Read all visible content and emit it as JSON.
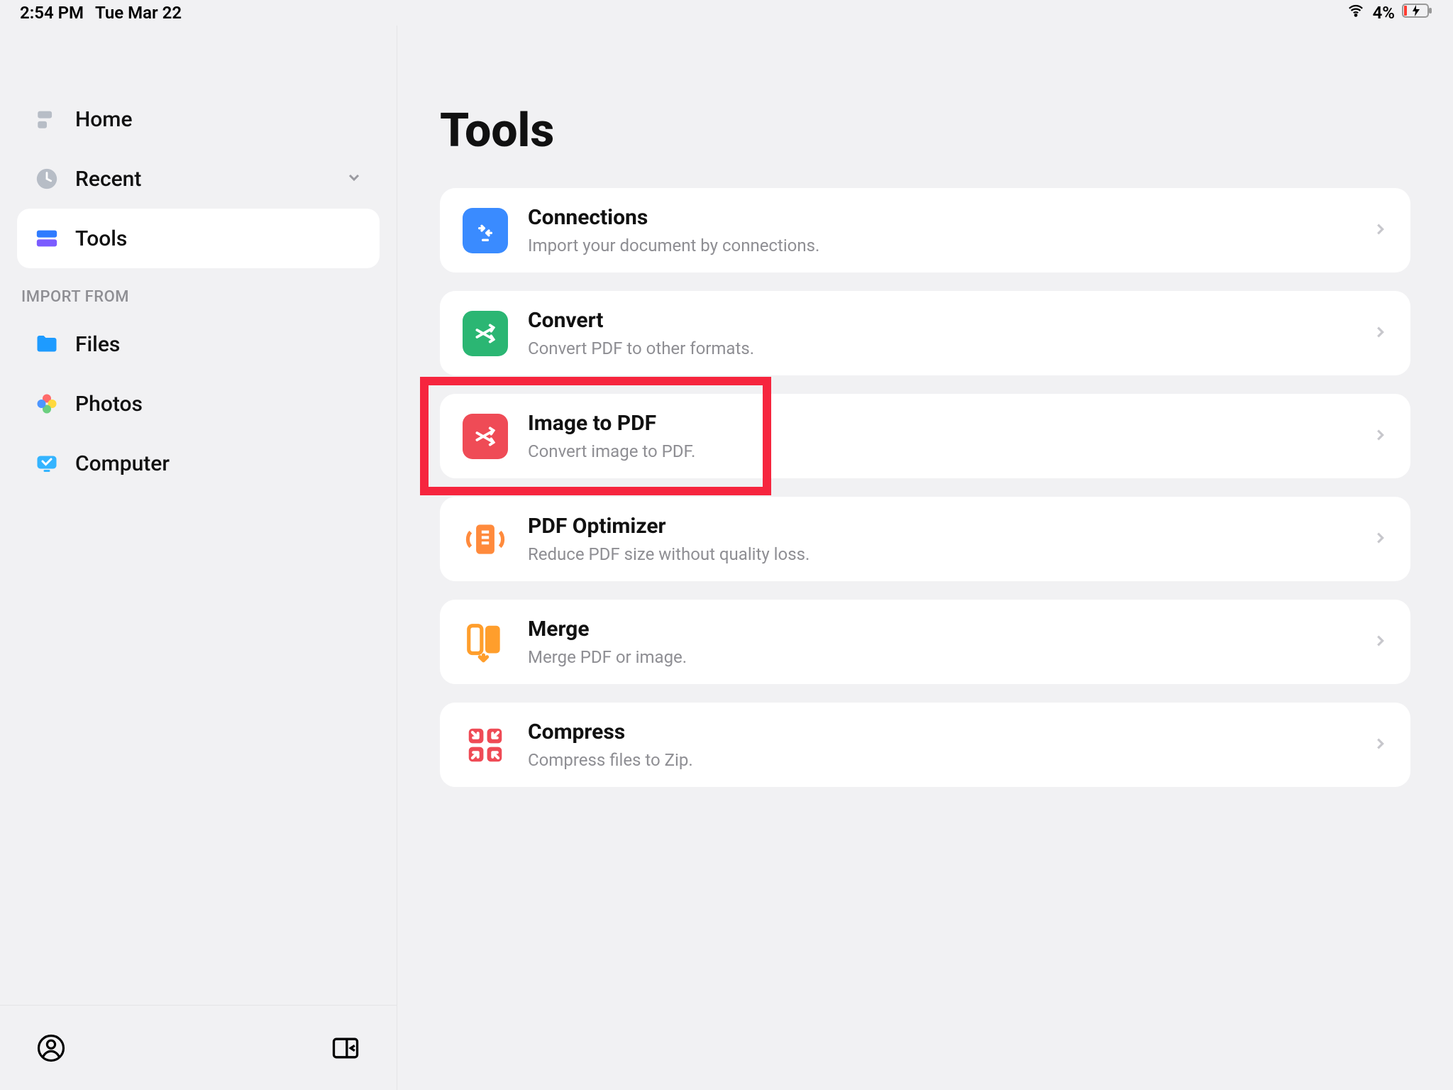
{
  "status": {
    "time": "2:54 PM",
    "date": "Tue Mar 22",
    "battery": "4%"
  },
  "sidebar": {
    "items": [
      {
        "label": "Home"
      },
      {
        "label": "Recent"
      },
      {
        "label": "Tools"
      }
    ],
    "section_label": "IMPORT FROM",
    "import_items": [
      {
        "label": "Files"
      },
      {
        "label": "Photos"
      },
      {
        "label": "Computer"
      }
    ]
  },
  "main": {
    "title": "Tools",
    "tools": [
      {
        "title": "Connections",
        "sub": "Import your document by connections."
      },
      {
        "title": "Convert",
        "sub": "Convert PDF to other formats."
      },
      {
        "title": "Image to PDF",
        "sub": "Convert image to PDF."
      },
      {
        "title": "PDF Optimizer",
        "sub": "Reduce PDF size without quality loss."
      },
      {
        "title": "Merge",
        "sub": "Merge PDF or image."
      },
      {
        "title": "Compress",
        "sub": "Compress files to Zip."
      }
    ]
  },
  "highlight": {
    "tool_index": 2
  }
}
